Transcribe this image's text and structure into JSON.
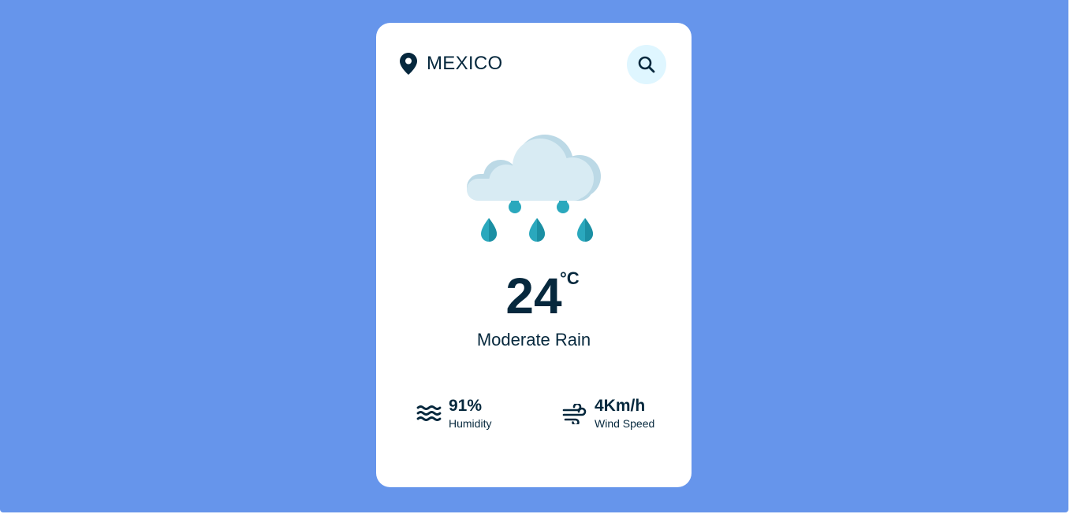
{
  "location": {
    "name": "MEXICO",
    "icon": "map-pin-icon"
  },
  "search": {
    "icon": "search-icon"
  },
  "weather": {
    "icon": "rain-cloud-icon",
    "temperature": "24",
    "unit": "°C",
    "description": "Moderate Rain"
  },
  "details": {
    "humidity": {
      "value": "91%",
      "label": "Humidity",
      "icon": "water-waves-icon"
    },
    "wind": {
      "value": "4Km/h",
      "label": "Wind Speed",
      "icon": "wind-icon"
    }
  },
  "colors": {
    "background": "#6695eb",
    "card": "#ffffff",
    "text": "#06283d",
    "search_bg": "#dff6ff",
    "cloud": "#d8ebf3",
    "cloud_shadow": "#bcd9e6",
    "raindrop": "#2aa8bd"
  }
}
